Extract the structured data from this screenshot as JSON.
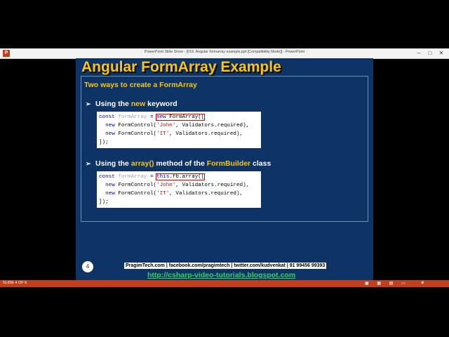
{
  "window": {
    "app_icon": "P",
    "title": "PowerPoint Slide Show - [019. Angular formarray example.ppt [Compatibility Mode]] - PowerPoint",
    "controls": {
      "minimize": "–",
      "maximize": "□",
      "close": "✕"
    }
  },
  "slide": {
    "title": "Angular FormArray Example",
    "subtitle": "Two ways to create a FormArray",
    "bullet1": {
      "pre": "Using the ",
      "hl": "new",
      "post": " keyword"
    },
    "code1": {
      "l1_kw": "const",
      "l1_var": " formArray ",
      "l1_eq": "= ",
      "l1_boxed_kw": "new",
      "l1_boxed_rest": " FormArray([",
      "l2_kw": "new",
      "l2_fn": " FormControl(",
      "l2_str": "'John'",
      "l2_rest": ", Validators.required),",
      "l3_kw": "new",
      "l3_fn": " FormControl(",
      "l3_str": "'IT'",
      "l3_rest": ", Validators.required),",
      "l4": "]);"
    },
    "bullet2": {
      "pre": "Using the ",
      "hl1": "array()",
      "mid": " method of the ",
      "hl2": "FormBuilder",
      "post": " class"
    },
    "code2": {
      "l1_kw": "const",
      "l1_var": " formArray ",
      "l1_eq": "= ",
      "l1_boxed_kw": "this",
      "l1_boxed_rest": ".fb.array([",
      "l2_kw": "new",
      "l2_fn": " FormControl(",
      "l2_str": "'John'",
      "l2_rest": ", Validators.required),",
      "l3_kw": "new",
      "l3_fn": " FormControl(",
      "l3_str": "'IT'",
      "l3_rest": ", Validators.required),",
      "l4": "]);"
    },
    "page_number": "4",
    "footer_info": "PragimTech.com | facebook.com/pragimtech | twitter.com/kudvenkat | 91 99456 99393",
    "footer_link": "http://csharp-video-tutorials.blogspot.com"
  },
  "statusbar": {
    "slide_count": "SLIDE 4 OF 6",
    "icons": [
      "normal-view-icon",
      "slide-sorter-icon",
      "reading-view-icon",
      "slideshow-icon"
    ],
    "icon_glyphs": "▣ ▦ ▤ ▭",
    "zoom_glyph": "⊕"
  },
  "colors": {
    "slide_bg": "#0e3466",
    "accent": "#f5c518",
    "statusbar": "#c43e1c",
    "link": "#2ed35a"
  }
}
